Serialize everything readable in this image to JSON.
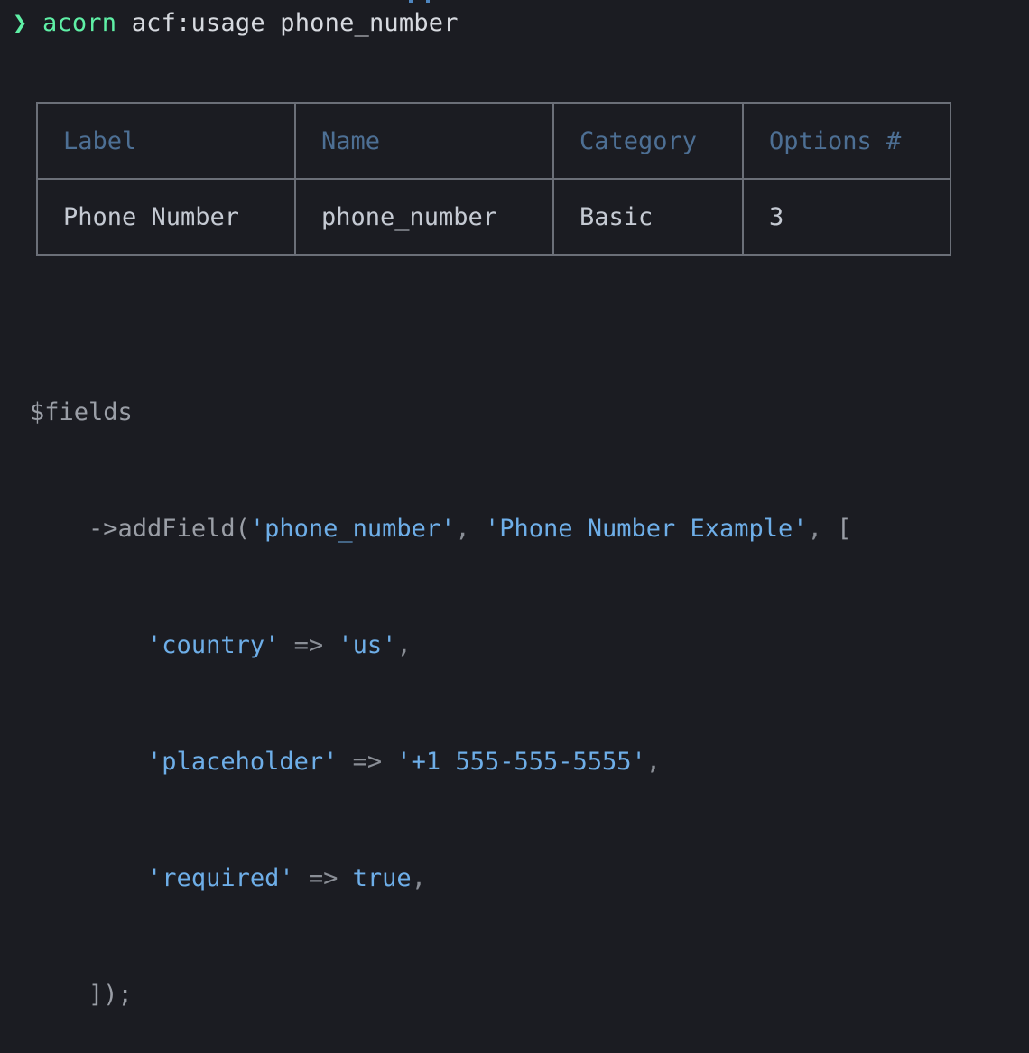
{
  "terminal": {
    "prompt_symbol": "❯",
    "command_bin": "acorn",
    "command_args": "acf:usage phone_number"
  },
  "usage_table": {
    "headers": [
      "Label",
      "Name",
      "Category",
      "Options #"
    ],
    "rows": [
      [
        "Phone Number",
        "phone_number",
        "Basic",
        "3"
      ]
    ]
  },
  "code_example": {
    "variable": "$fields",
    "method_call": "->addField(",
    "field_name": "'phone_number'",
    "field_label": "'Phone Number Example'",
    "open_bracket": "[",
    "options": [
      {
        "key": "'country'",
        "arrow": "=>",
        "value": "'us'"
      },
      {
        "key": "'placeholder'",
        "arrow": "=>",
        "value": "'+1 555-555-5555'"
      },
      {
        "key": "'required'",
        "arrow": "=>",
        "value": "true"
      }
    ],
    "close": "]);"
  },
  "colors": {
    "background": "#1b1c22",
    "prompt_green": "#5ff0a6",
    "header_blue": "#4d6f94",
    "string_blue": "#6eaee8",
    "border_gray": "#6b6f78"
  }
}
